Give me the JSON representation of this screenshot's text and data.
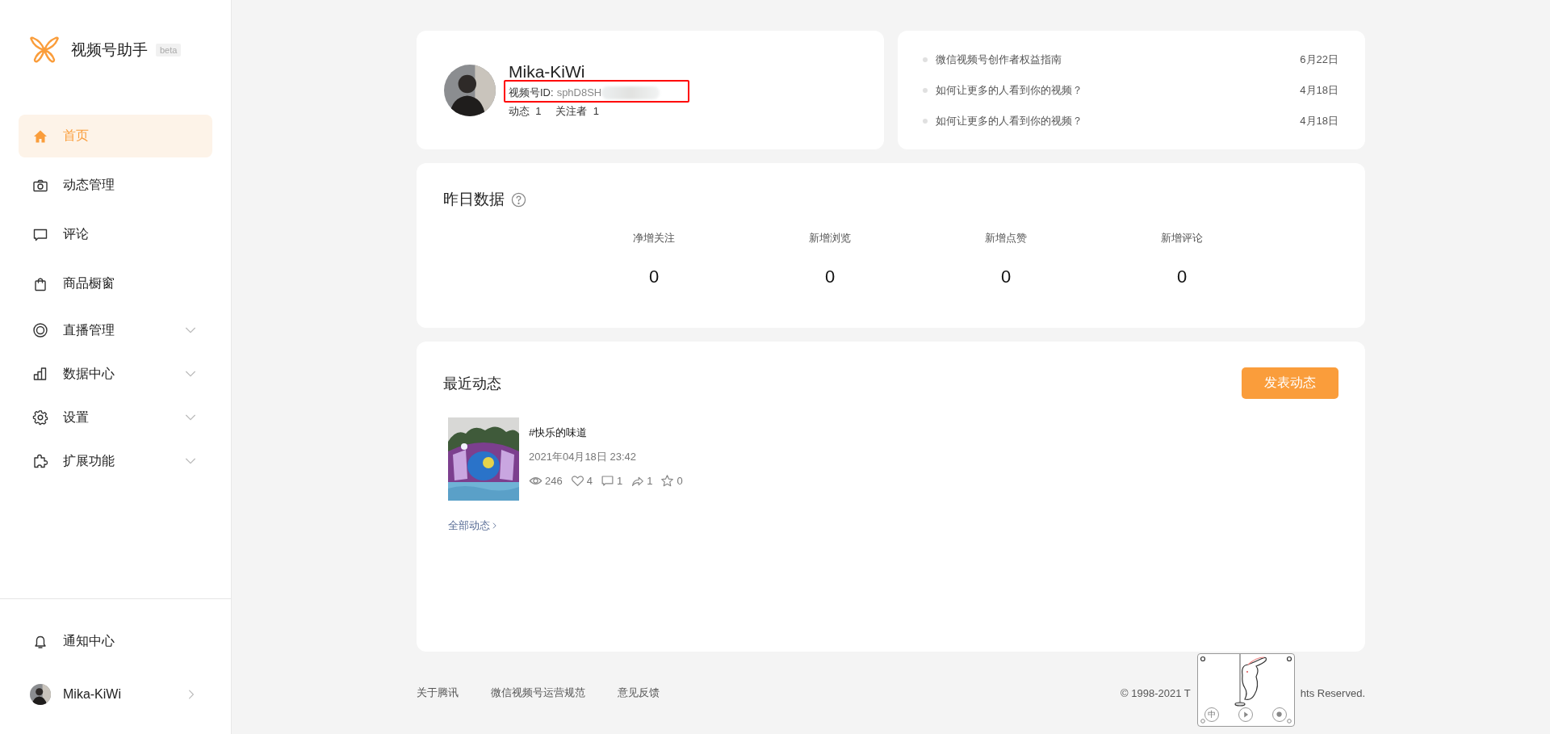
{
  "sidebar": {
    "logo_text": "视频号助手",
    "badge": "beta",
    "items": [
      {
        "label": "首页",
        "selected": true,
        "expandable": false
      },
      {
        "label": "动态管理",
        "selected": false,
        "expandable": false
      },
      {
        "label": "评论",
        "selected": false,
        "expandable": false
      },
      {
        "label": "商品橱窗",
        "selected": false,
        "expandable": false
      },
      {
        "label": "直播管理",
        "selected": false,
        "expandable": true
      },
      {
        "label": "数据中心",
        "selected": false,
        "expandable": true
      },
      {
        "label": "设置",
        "selected": false,
        "expandable": true
      },
      {
        "label": "扩展功能",
        "selected": false,
        "expandable": true
      }
    ],
    "bottom_items": [
      {
        "label": "通知中心",
        "kind": "notice"
      },
      {
        "label": "Mika-KiWi",
        "kind": "account"
      }
    ]
  },
  "profile": {
    "name": "Mika-KiWi",
    "id_label": "视频号ID:",
    "id_value": "sphD8SH",
    "stats": [
      {
        "label": "动态",
        "value": "1"
      },
      {
        "label": "关注者",
        "value": "1"
      }
    ]
  },
  "news": [
    {
      "title": "微信视频号创作者权益指南",
      "date": "6月22日"
    },
    {
      "title": "如何让更多的人看到你的视频？",
      "date": "4月18日"
    },
    {
      "title": "如何让更多的人看到你的视频？",
      "date": "4月18日"
    }
  ],
  "yesterday": {
    "title": "昨日数据",
    "metrics": [
      {
        "label": "净增关注",
        "value": "0"
      },
      {
        "label": "新增浏览",
        "value": "0"
      },
      {
        "label": "新增点赞",
        "value": "0"
      },
      {
        "label": "新增评论",
        "value": "0"
      }
    ]
  },
  "recent": {
    "title": "最近动态",
    "publish_button": "发表动态",
    "all_link": "全部动态",
    "posts": [
      {
        "title": "#快乐的味道",
        "time": "2021年04月18日 23:42",
        "stats": [
          {
            "kind": "views",
            "value": "246"
          },
          {
            "kind": "likes",
            "value": "4"
          },
          {
            "kind": "comments",
            "value": "1"
          },
          {
            "kind": "shares",
            "value": "1"
          },
          {
            "kind": "favorites",
            "value": "0"
          }
        ]
      }
    ]
  },
  "footer": {
    "links": [
      "关于腾讯",
      "微信视频号运营规范",
      "意见反馈"
    ],
    "copyright_parts": [
      "© 1998-2021 T",
      "hts Reserved."
    ]
  },
  "widget": {
    "ime_label": "中"
  }
}
